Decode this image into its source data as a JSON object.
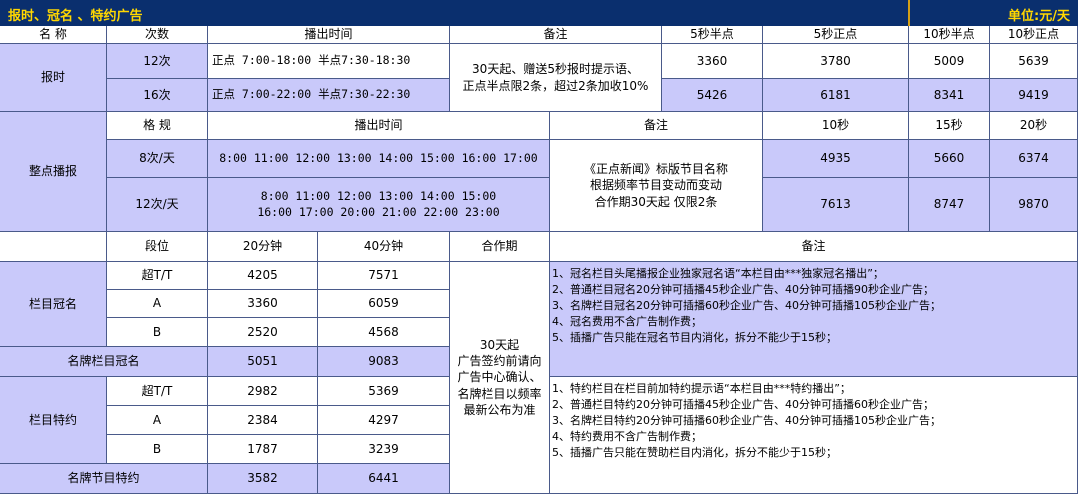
{
  "title": {
    "left": "报时、冠名 、特约广告",
    "right": "单位:元/天"
  },
  "header": {
    "name": "名 称",
    "times": "次数",
    "air_time": "播出时间",
    "remark": "备注",
    "c1": "5秒半点",
    "c2": "5秒正点",
    "c3": "10秒半点",
    "c4": "10秒正点"
  },
  "baoshi": {
    "name": "报时",
    "rows": [
      {
        "times": "12次",
        "air": "正点 7:00-18:00 半点7:30-18:30",
        "v": [
          "3360",
          "3780",
          "5009",
          "5639"
        ]
      },
      {
        "times": "16次",
        "air": "正点 7:00-22:00 半点7:30-22:30",
        "v": [
          "5426",
          "6181",
          "8341",
          "9419"
        ]
      }
    ],
    "remark": [
      "30天起、赠送5秒报时提示语、",
      "正点半点限2条，超过2条加收10%"
    ]
  },
  "zhengdian": {
    "name": "整点播报",
    "header": {
      "spec": "格 规",
      "air": "播出时间",
      "remark": "备注",
      "c1": "10秒",
      "c2": "15秒",
      "c3": "20秒"
    },
    "rows": [
      {
        "spec": "8次/天",
        "air": [
          "8:00 11:00 12:00 13:00 14:00 15:00 16:00 17:00"
        ],
        "v": [
          "4935",
          "5660",
          "6374"
        ]
      },
      {
        "spec": "12次/天",
        "air": [
          "8:00 11:00 12:00 13:00 14:00 15:00",
          "16:00 17:00 20:00 21:00 22:00 23:00"
        ],
        "v": [
          "7613",
          "8747",
          "9870"
        ]
      }
    ],
    "remark": [
      "《正点新闻》标版节目名称",
      "根据频率节目变动而变动",
      "合作期30天起 仅限2条"
    ]
  },
  "guanming": {
    "header": {
      "seg": "段位",
      "c1": "20分钟",
      "c2": "40分钟",
      "period": "合作期",
      "remark": "备注"
    },
    "name": "栏目冠名",
    "rows": [
      {
        "seg": "超T/T",
        "v": [
          "4205",
          "7571"
        ]
      },
      {
        "seg": "A",
        "v": [
          "3360",
          "6059"
        ]
      },
      {
        "seg": "B",
        "v": [
          "2520",
          "4568"
        ]
      }
    ],
    "brand": {
      "name": "名牌栏目冠名",
      "v": [
        "5051",
        "9083"
      ]
    },
    "notes": [
      "1、冠名栏目头尾播报企业独家冠名语“本栏目由***独家冠名播出”；",
      "2、普通栏目冠名20分钟可插播45秒企业广告、40分钟可插播90秒企业广告；",
      "3、名牌栏目冠名20分钟可插播60秒企业广告、40分钟可插播105秒企业广告；",
      "4、冠名费用不含广告制作费；",
      "5、插播广告只能在冠名节目内消化，拆分不能少于15秒；"
    ]
  },
  "period_text": [
    "30天起",
    "广告签约前请向",
    "广告中心确认、",
    "名牌栏目以频率",
    "最新公布为准"
  ],
  "teyue": {
    "name": "栏目特约",
    "rows": [
      {
        "seg": "超T/T",
        "v": [
          "2982",
          "5369"
        ]
      },
      {
        "seg": "A",
        "v": [
          "2384",
          "4297"
        ]
      },
      {
        "seg": "B",
        "v": [
          "1787",
          "3239"
        ]
      }
    ],
    "brand": {
      "name": "名牌节目特约",
      "v": [
        "3582",
        "6441"
      ]
    },
    "notes": [
      "1、特约栏目在栏目前加特约提示语“本栏目由***特约播出”；",
      "2、普通栏目特约20分钟可插播45秒企业广告、40分钟可插播60秒企业广告；",
      "3、名牌栏目特约20分钟可插播60秒企业广告、40分钟可插播105秒企业广告；",
      "4、特约费用不含广告制作费；",
      "5、插播广告只能在赞助栏目内消化，拆分不能少于15秒；"
    ]
  }
}
